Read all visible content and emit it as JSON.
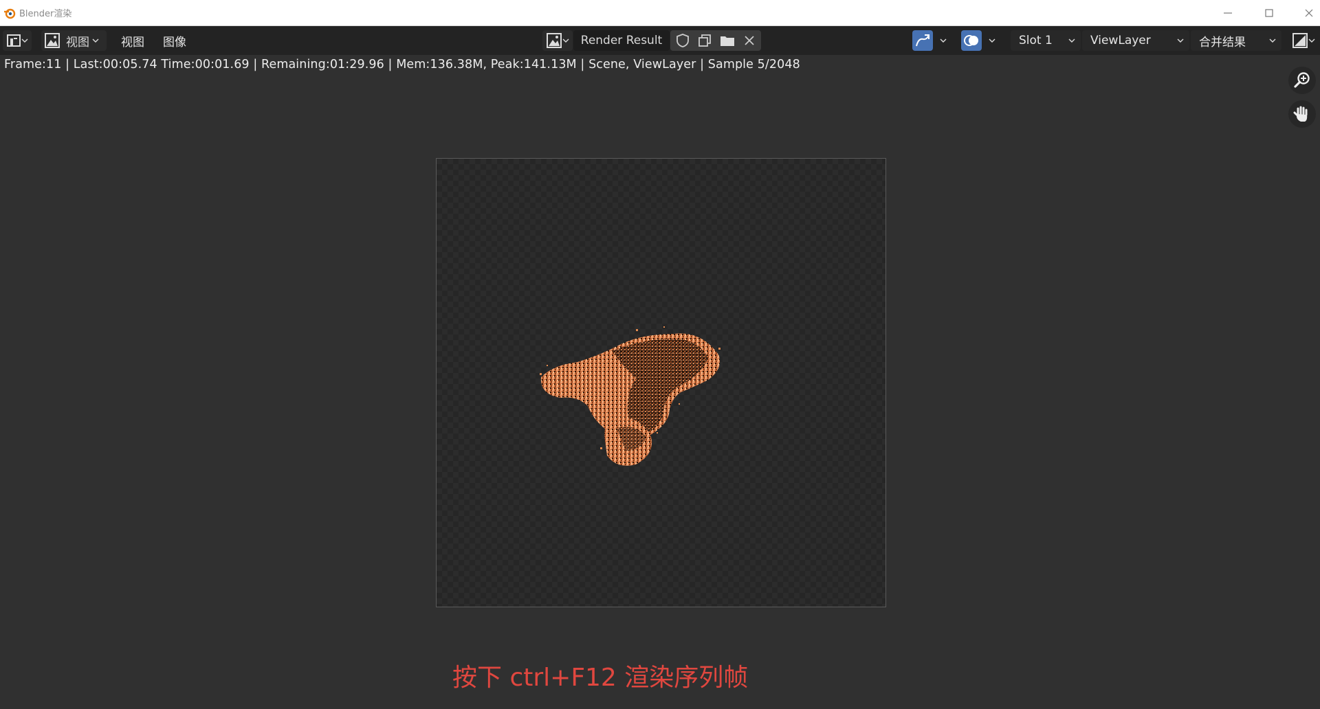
{
  "window": {
    "title": "Blender渲染",
    "controls": [
      "minimize",
      "maximize",
      "close"
    ]
  },
  "header": {
    "menus": [
      "视图",
      "视图",
      "图像"
    ],
    "image_name": "Render Result",
    "slot": "Slot 1",
    "view_layer": "ViewLayer",
    "pass": "合并结果"
  },
  "status": {
    "text": "Frame:11 | Last:00:05.74 Time:00:01.69 | Remaining:01:29.96 | Mem:136.38M, Peak:141.13M | Scene, ViewLayer | Sample 5/2048"
  },
  "caption": {
    "text": "按下 ctrl+F12 渲染序列帧"
  },
  "icons": {
    "editor_type": "image-editor-icon",
    "mode": "image-mode-icon",
    "browse": "image-browse-icon",
    "fake_user": "shield-icon",
    "new_image": "duplicate-icon",
    "open": "folder-icon",
    "unlink": "close-icon",
    "sample": "sample-icon",
    "overlay": "overlay-icon",
    "display_channels": "display-channels-icon",
    "zoom": "zoom-icon",
    "pan": "hand-icon"
  },
  "colors": {
    "accent": "#4772b3",
    "caption": "#e0473f",
    "background": "#303030"
  }
}
